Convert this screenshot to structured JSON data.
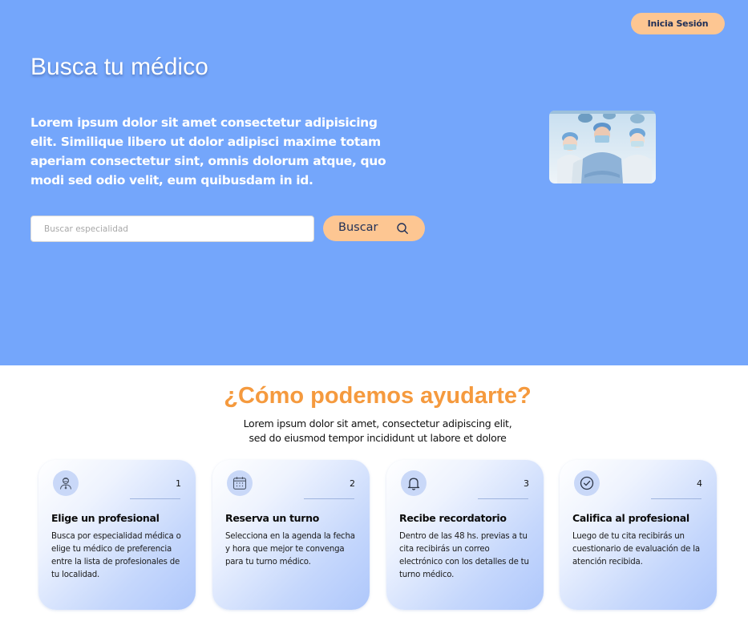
{
  "header": {
    "login_label": "Inicia Sesión"
  },
  "hero": {
    "title": "Busca tu médico",
    "description": "Lorem ipsum dolor sit amet consectetur adipisicing elit. Similique libero ut dolor adipisci maxime totam aperiam consectetur sint, omnis dolorum atque, quo modi sed odio velit, eum quibusdam in id.",
    "search_placeholder": "Buscar especialidad",
    "search_value": "",
    "search_button_label": "Buscar",
    "search_icon": "search-icon",
    "photo": "doctors-team-photo"
  },
  "help": {
    "title": "¿Cómo podemos ayudarte?",
    "subtitle_line1": "Lorem ipsum dolor sit amet, consectetur adipiscing elit,",
    "subtitle_line2": "sed do eiusmod tempor incididunt ut labore et dolore",
    "cards": [
      {
        "number": "1",
        "icon": "doctor-icon",
        "title": "Elige un profesional",
        "text": "Busca por especialidad médica o elige tu médico de preferencia entre la lista de profesionales de tu localidad."
      },
      {
        "number": "2",
        "icon": "calendar-icon",
        "title": "Reserva un turno",
        "text": "Selecciona en la agenda la fecha y hora que mejor te convenga para tu turno médico."
      },
      {
        "number": "3",
        "icon": "bell-icon",
        "title": "Recibe recordatorio",
        "text": "Dentro de las 48 hs. previas a tu cita recibirás un correo electrónico con los detalles de tu turno médico."
      },
      {
        "number": "4",
        "icon": "check-circle-icon",
        "title": "Califica al profesional",
        "text": "Luego de tu cita recibirás un cuestionario de evaluación de la atención recibida."
      }
    ]
  },
  "colors": {
    "hero_bg": "#74a6fb",
    "accent": "#fdc692",
    "title_orange": "#f59a3e",
    "card_icon_bg": "#c9d8f8"
  }
}
